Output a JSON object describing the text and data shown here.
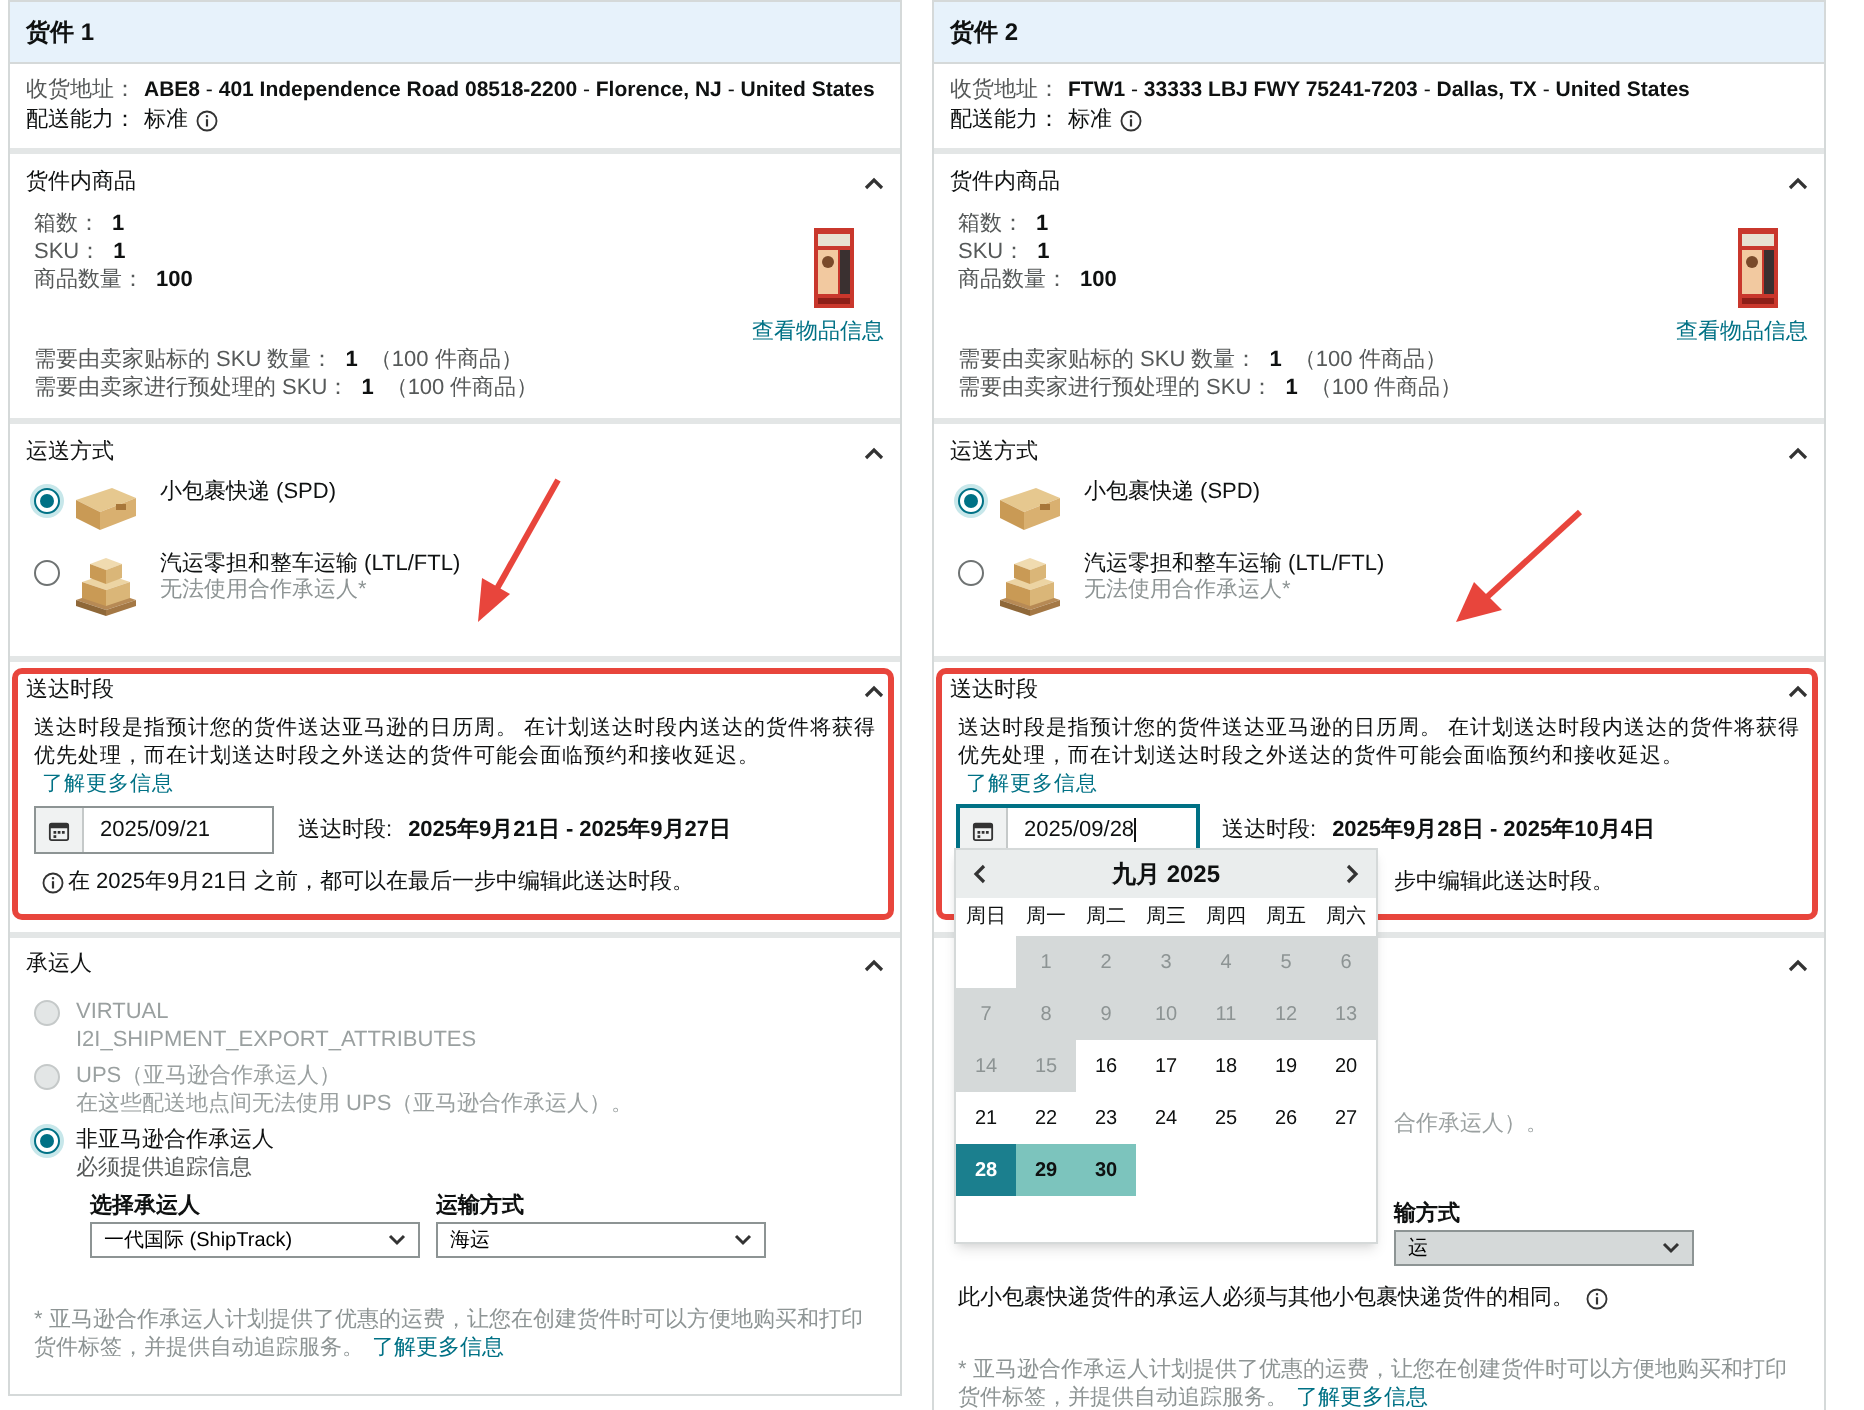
{
  "shipments": [
    {
      "title": "货件 1",
      "address": {
        "label": "收货地址：",
        "value": "**ABE8** - **401 Independence Road 08518-2200** - **Florence, NJ** - **United States**"
      },
      "capability": {
        "label": "配送能力：",
        "value": "标准"
      },
      "contents": {
        "title": "货件内商品",
        "expanded": true,
        "stats": [
          {
            "label": "箱数：",
            "value": "1"
          },
          {
            "label": "SKU：",
            "value": "1"
          },
          {
            "label": "商品数量：",
            "value": "100"
          }
        ],
        "link": "查看物品信息",
        "notes": [
          {
            "label": "需要由卖家贴标的 SKU 数量：",
            "value": "1",
            "extra": "（100 件商品）"
          },
          {
            "label": "需要由卖家进行预处理的 SKU：",
            "value": "1",
            "extra": "（100 件商品）"
          }
        ]
      },
      "shipping": {
        "title": "运送方式",
        "expanded": true,
        "options": [
          {
            "kind": "box",
            "label": "小包裹快递 (SPD)",
            "selected": true
          },
          {
            "kind": "pallet",
            "label": "汽运零担和整车运输 (LTL/FTL)",
            "sublabel": "无法使用合作承运人*",
            "selected": false
          }
        ]
      },
      "delivery": {
        "title": "送达时段",
        "expanded": true,
        "highlighted": true,
        "description": "送达时段是指预计您的货件送达亚马逊的日历周。 在计划送达时段内送达的货件将获得优先处理，而在计划送达时段之外送达的货件可能会面临预约和接收延迟。",
        "link": "了解更多信息",
        "date": "2025/09/21",
        "focused": false,
        "window_label": "送达时段:",
        "window_value": "2025年9月21日 - 2025年9月27日",
        "hint": "在 2025年9月21日 之前，都可以在最后一步中编辑此送达时段。"
      },
      "carrier": {
        "kind": "full",
        "title": "承运人",
        "expanded": true,
        "options": [
          {
            "label": "VIRTUAL",
            "sublabel": "I2I_SHIPMENT_EXPORT_ATTRIBUTES",
            "disabled": true,
            "selected": false
          },
          {
            "label": "UPS（亚马逊合作承运人）",
            "sublabel": "在这些配送地点间无法使用 UPS（亚马逊合作承运人）。",
            "disabled": true,
            "selected": false
          },
          {
            "label": "非亚马逊合作承运人",
            "sublabel": "必须提供追踪信息",
            "disabled": false,
            "selected": true
          }
        ],
        "selects": [
          {
            "label": "选择承运人",
            "value": "一代国际 (ShipTrack)",
            "disabled": false
          },
          {
            "label": "运输方式",
            "value": "海运",
            "disabled": false
          }
        ],
        "footnote": "* 亚马逊合作承运人计划提供了优惠的运费，让您在创建货件时可以方便地购买和打印货件标签，并提供自动追踪服务。",
        "link": "了解更多信息"
      }
    },
    {
      "title": "货件 2",
      "address": {
        "label": "收货地址：",
        "value": "**FTW1** - **33333 LBJ FWY 75241-7203** - **Dallas, TX** - **United States**"
      },
      "capability": {
        "label": "配送能力：",
        "value": "标准"
      },
      "contents": {
        "title": "货件内商品",
        "expanded": true,
        "stats": [
          {
            "label": "箱数：",
            "value": "1"
          },
          {
            "label": "SKU：",
            "value": "1"
          },
          {
            "label": "商品数量：",
            "value": "100"
          }
        ],
        "link": "查看物品信息",
        "notes": [
          {
            "label": "需要由卖家贴标的 SKU 数量：",
            "value": "1",
            "extra": "（100 件商品）"
          },
          {
            "label": "需要由卖家进行预处理的 SKU：",
            "value": "1",
            "extra": "（100 件商品）"
          }
        ]
      },
      "shipping": {
        "title": "运送方式",
        "expanded": true,
        "options": [
          {
            "kind": "box",
            "label": "小包裹快递 (SPD)",
            "selected": true
          },
          {
            "kind": "pallet",
            "label": "汽运零担和整车运输 (LTL/FTL)",
            "sublabel": "无法使用合作承运人*",
            "selected": false
          }
        ]
      },
      "delivery": {
        "title": "送达时段",
        "expanded": true,
        "highlighted": true,
        "description": "送达时段是指预计您的货件送达亚马逊的日历周。 在计划送达时段内送达的货件将获得优先处理，而在计划送达时段之外送达的货件可能会面临预约和接收延迟。",
        "link": "了解更多信息",
        "date": "2025/09/28",
        "focused": true,
        "window_label": "送达时段:",
        "window_value": "2025年9月28日 - 2025年10月4日",
        "hint": "步中编辑此送达时段。",
        "calendar": {
          "month": "九月 2025",
          "weekdays": [
            "周日",
            "周一",
            "周二",
            "周三",
            "周四",
            "周五",
            "周六"
          ],
          "days": [
            {
              "kind": "blank"
            },
            {
              "kind": "day",
              "label": "1",
              "disabled": true,
              "in_range": false,
              "selected": false
            },
            {
              "kind": "day",
              "label": "2",
              "disabled": true,
              "in_range": false,
              "selected": false
            },
            {
              "kind": "day",
              "label": "3",
              "disabled": true,
              "in_range": false,
              "selected": false
            },
            {
              "kind": "day",
              "label": "4",
              "disabled": true,
              "in_range": false,
              "selected": false
            },
            {
              "kind": "day",
              "label": "5",
              "disabled": true,
              "in_range": false,
              "selected": false
            },
            {
              "kind": "day",
              "label": "6",
              "disabled": true,
              "in_range": false,
              "selected": false
            },
            {
              "kind": "day",
              "label": "7",
              "disabled": true,
              "in_range": false,
              "selected": false
            },
            {
              "kind": "day",
              "label": "8",
              "disabled": true,
              "in_range": false,
              "selected": false
            },
            {
              "kind": "day",
              "label": "9",
              "disabled": true,
              "in_range": false,
              "selected": false
            },
            {
              "kind": "day",
              "label": "10",
              "disabled": true,
              "in_range": false,
              "selected": false
            },
            {
              "kind": "day",
              "label": "11",
              "disabled": true,
              "in_range": false,
              "selected": false
            },
            {
              "kind": "day",
              "label": "12",
              "disabled": true,
              "in_range": false,
              "selected": false
            },
            {
              "kind": "day",
              "label": "13",
              "disabled": true,
              "in_range": false,
              "selected": false
            },
            {
              "kind": "day",
              "label": "14",
              "disabled": true,
              "in_range": false,
              "selected": false
            },
            {
              "kind": "day",
              "label": "15",
              "disabled": true,
              "in_range": false,
              "selected": false
            },
            {
              "kind": "day",
              "label": "16",
              "disabled": false,
              "in_range": false,
              "selected": false
            },
            {
              "kind": "day",
              "label": "17",
              "disabled": false,
              "in_range": false,
              "selected": false
            },
            {
              "kind": "day",
              "label": "18",
              "disabled": false,
              "in_range": false,
              "selected": false
            },
            {
              "kind": "day",
              "label": "19",
              "disabled": false,
              "in_range": false,
              "selected": false
            },
            {
              "kind": "day",
              "label": "20",
              "disabled": false,
              "in_range": false,
              "selected": false
            },
            {
              "kind": "day",
              "label": "21",
              "disabled": false,
              "in_range": false,
              "selected": false
            },
            {
              "kind": "day",
              "label": "22",
              "disabled": false,
              "in_range": false,
              "selected": false
            },
            {
              "kind": "day",
              "label": "23",
              "disabled": false,
              "in_range": false,
              "selected": false
            },
            {
              "kind": "day",
              "label": "24",
              "disabled": false,
              "in_range": false,
              "selected": false
            },
            {
              "kind": "day",
              "label": "25",
              "disabled": false,
              "in_range": false,
              "selected": false
            },
            {
              "kind": "day",
              "label": "26",
              "disabled": false,
              "in_range": false,
              "selected": false
            },
            {
              "kind": "day",
              "label": "27",
              "disabled": false,
              "in_range": false,
              "selected": false
            },
            {
              "kind": "day",
              "label": "28",
              "disabled": false,
              "in_range": false,
              "selected": true
            },
            {
              "kind": "day",
              "label": "29",
              "disabled": false,
              "in_range": true,
              "selected": false
            },
            {
              "kind": "day",
              "label": "30",
              "disabled": false,
              "in_range": true,
              "selected": false
            }
          ]
        }
      },
      "carrier": {
        "kind": "partial",
        "expanded": true,
        "fragment": "合作承运人）。",
        "selects": [
          {
            "label": "输方式",
            "value": "运",
            "disabled": true
          }
        ],
        "note": "此小包裹快递货件的承运人必须与其他小包裹快递货件的相同。",
        "footnote": "* 亚马逊合作承运人计划提供了优惠的运费，让您在创建货件时可以方便地购买和打印货件标签，并提供自动追踪服务。",
        "link": "了解更多信息"
      }
    }
  ]
}
